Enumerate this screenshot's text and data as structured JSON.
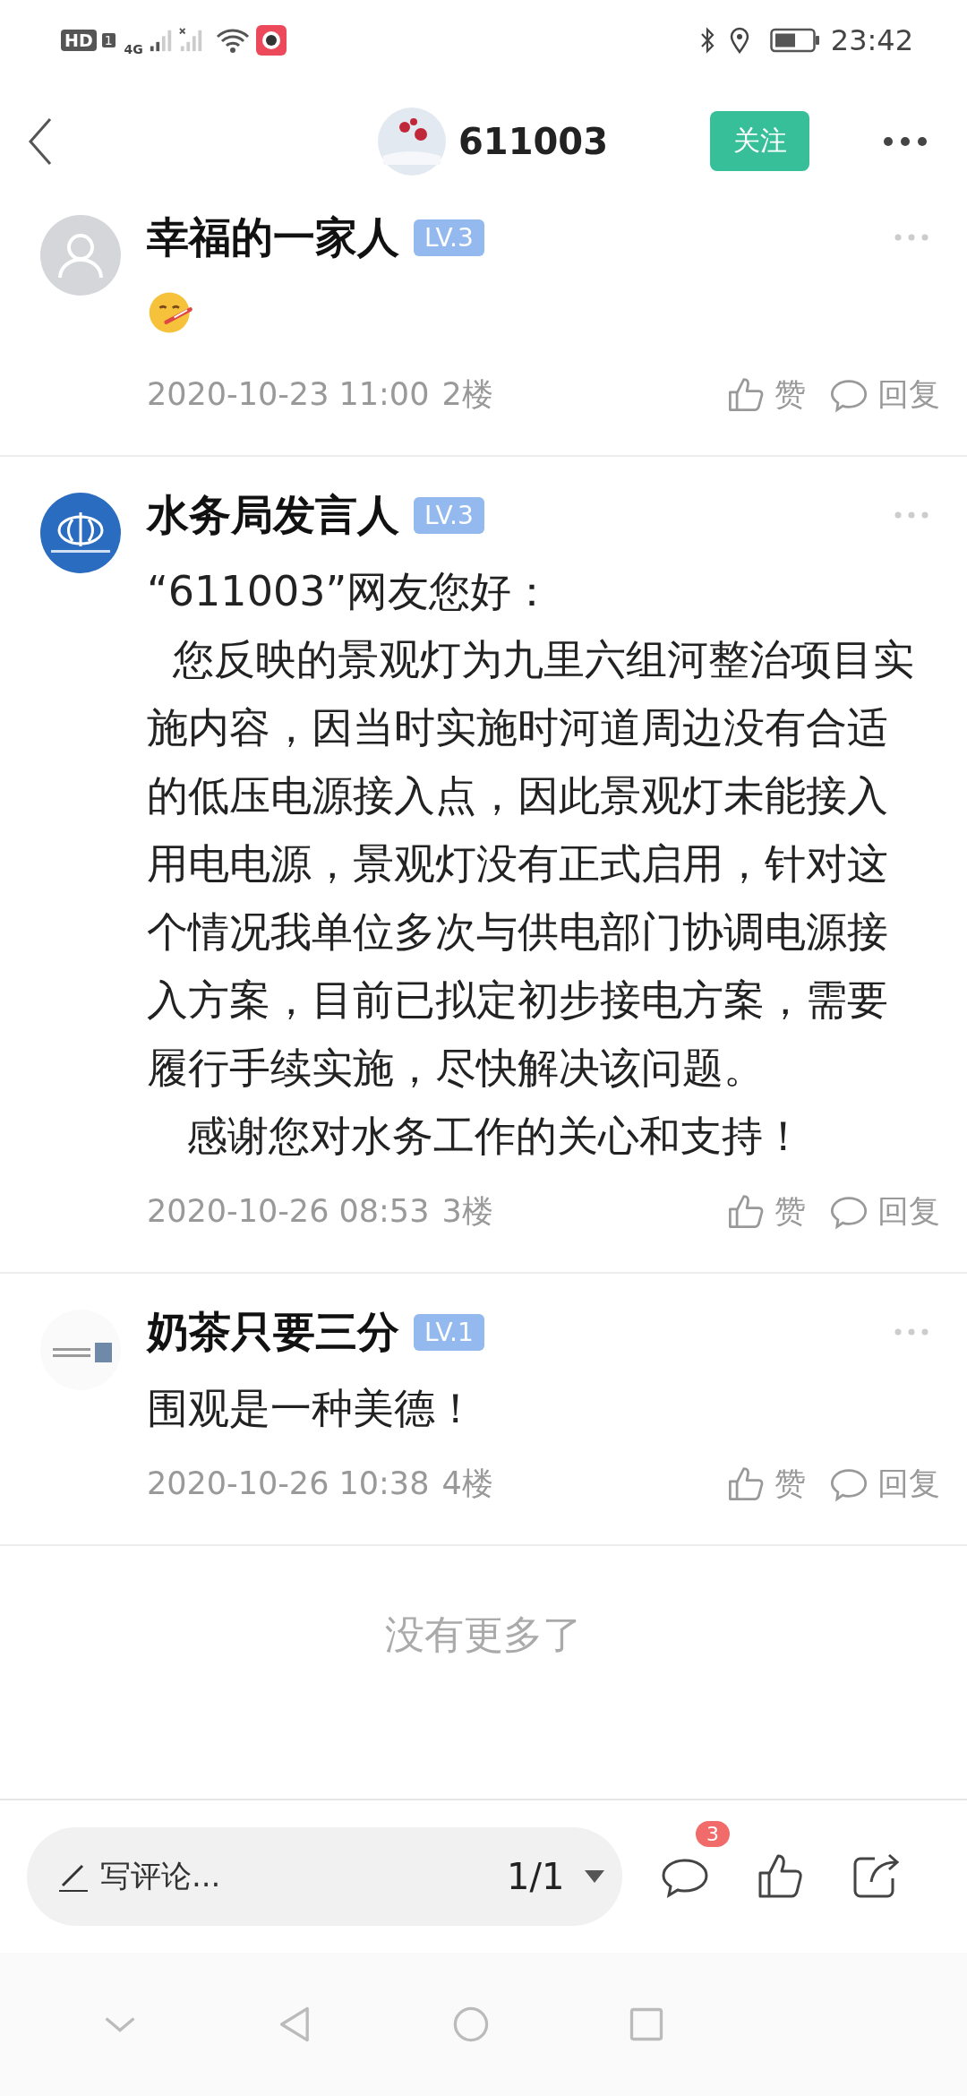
{
  "status_bar": {
    "hd": "HD",
    "sim": "1",
    "network": "4G",
    "time": "23:42"
  },
  "header": {
    "title": "611003",
    "follow_label": "关注",
    "following": false
  },
  "comments": [
    {
      "avatar": {
        "kind": "default"
      },
      "kind": "emoji",
      "name": "幸福的一家人",
      "level": "LV.3",
      "time": "2020-10-23 11:00",
      "floor": "2楼",
      "like": "赞",
      "reply": "回复"
    },
    {
      "avatar": {
        "kind": "logo"
      },
      "kind": "text",
      "name": "水务局发言人",
      "level": "LV.3",
      "paragraphs": [
        "“611003”网友您好：",
        "  您反映的景观灯为九里六组河整治项目实施内容，因当时实施时河道周边没有合适的低压电源接入点，因此景观灯未能接入用电电源，景观灯没有正式启用，针对这个情况我单位多次与供电部门协调电源接入方案，目前已拟定初步接电方案，需要履行手续实施，尽快解决该问题。",
        "   感谢您对水务工作的关心和支持！"
      ],
      "time": "2020-10-26 08:53",
      "floor": "3楼",
      "like": "赞",
      "reply": "回复"
    },
    {
      "avatar": {
        "kind": "photo"
      },
      "kind": "text",
      "name": "奶茶只要三分",
      "level": "LV.1",
      "paragraphs": [
        "围观是一种美德！"
      ],
      "time": "2020-10-26 10:38",
      "floor": "4楼",
      "like": "赞",
      "reply": "回复"
    }
  ],
  "end_note": "没有更多了",
  "bottom_bar": {
    "placeholder": "写评论...",
    "page": "1/1",
    "comment_count": "3"
  }
}
